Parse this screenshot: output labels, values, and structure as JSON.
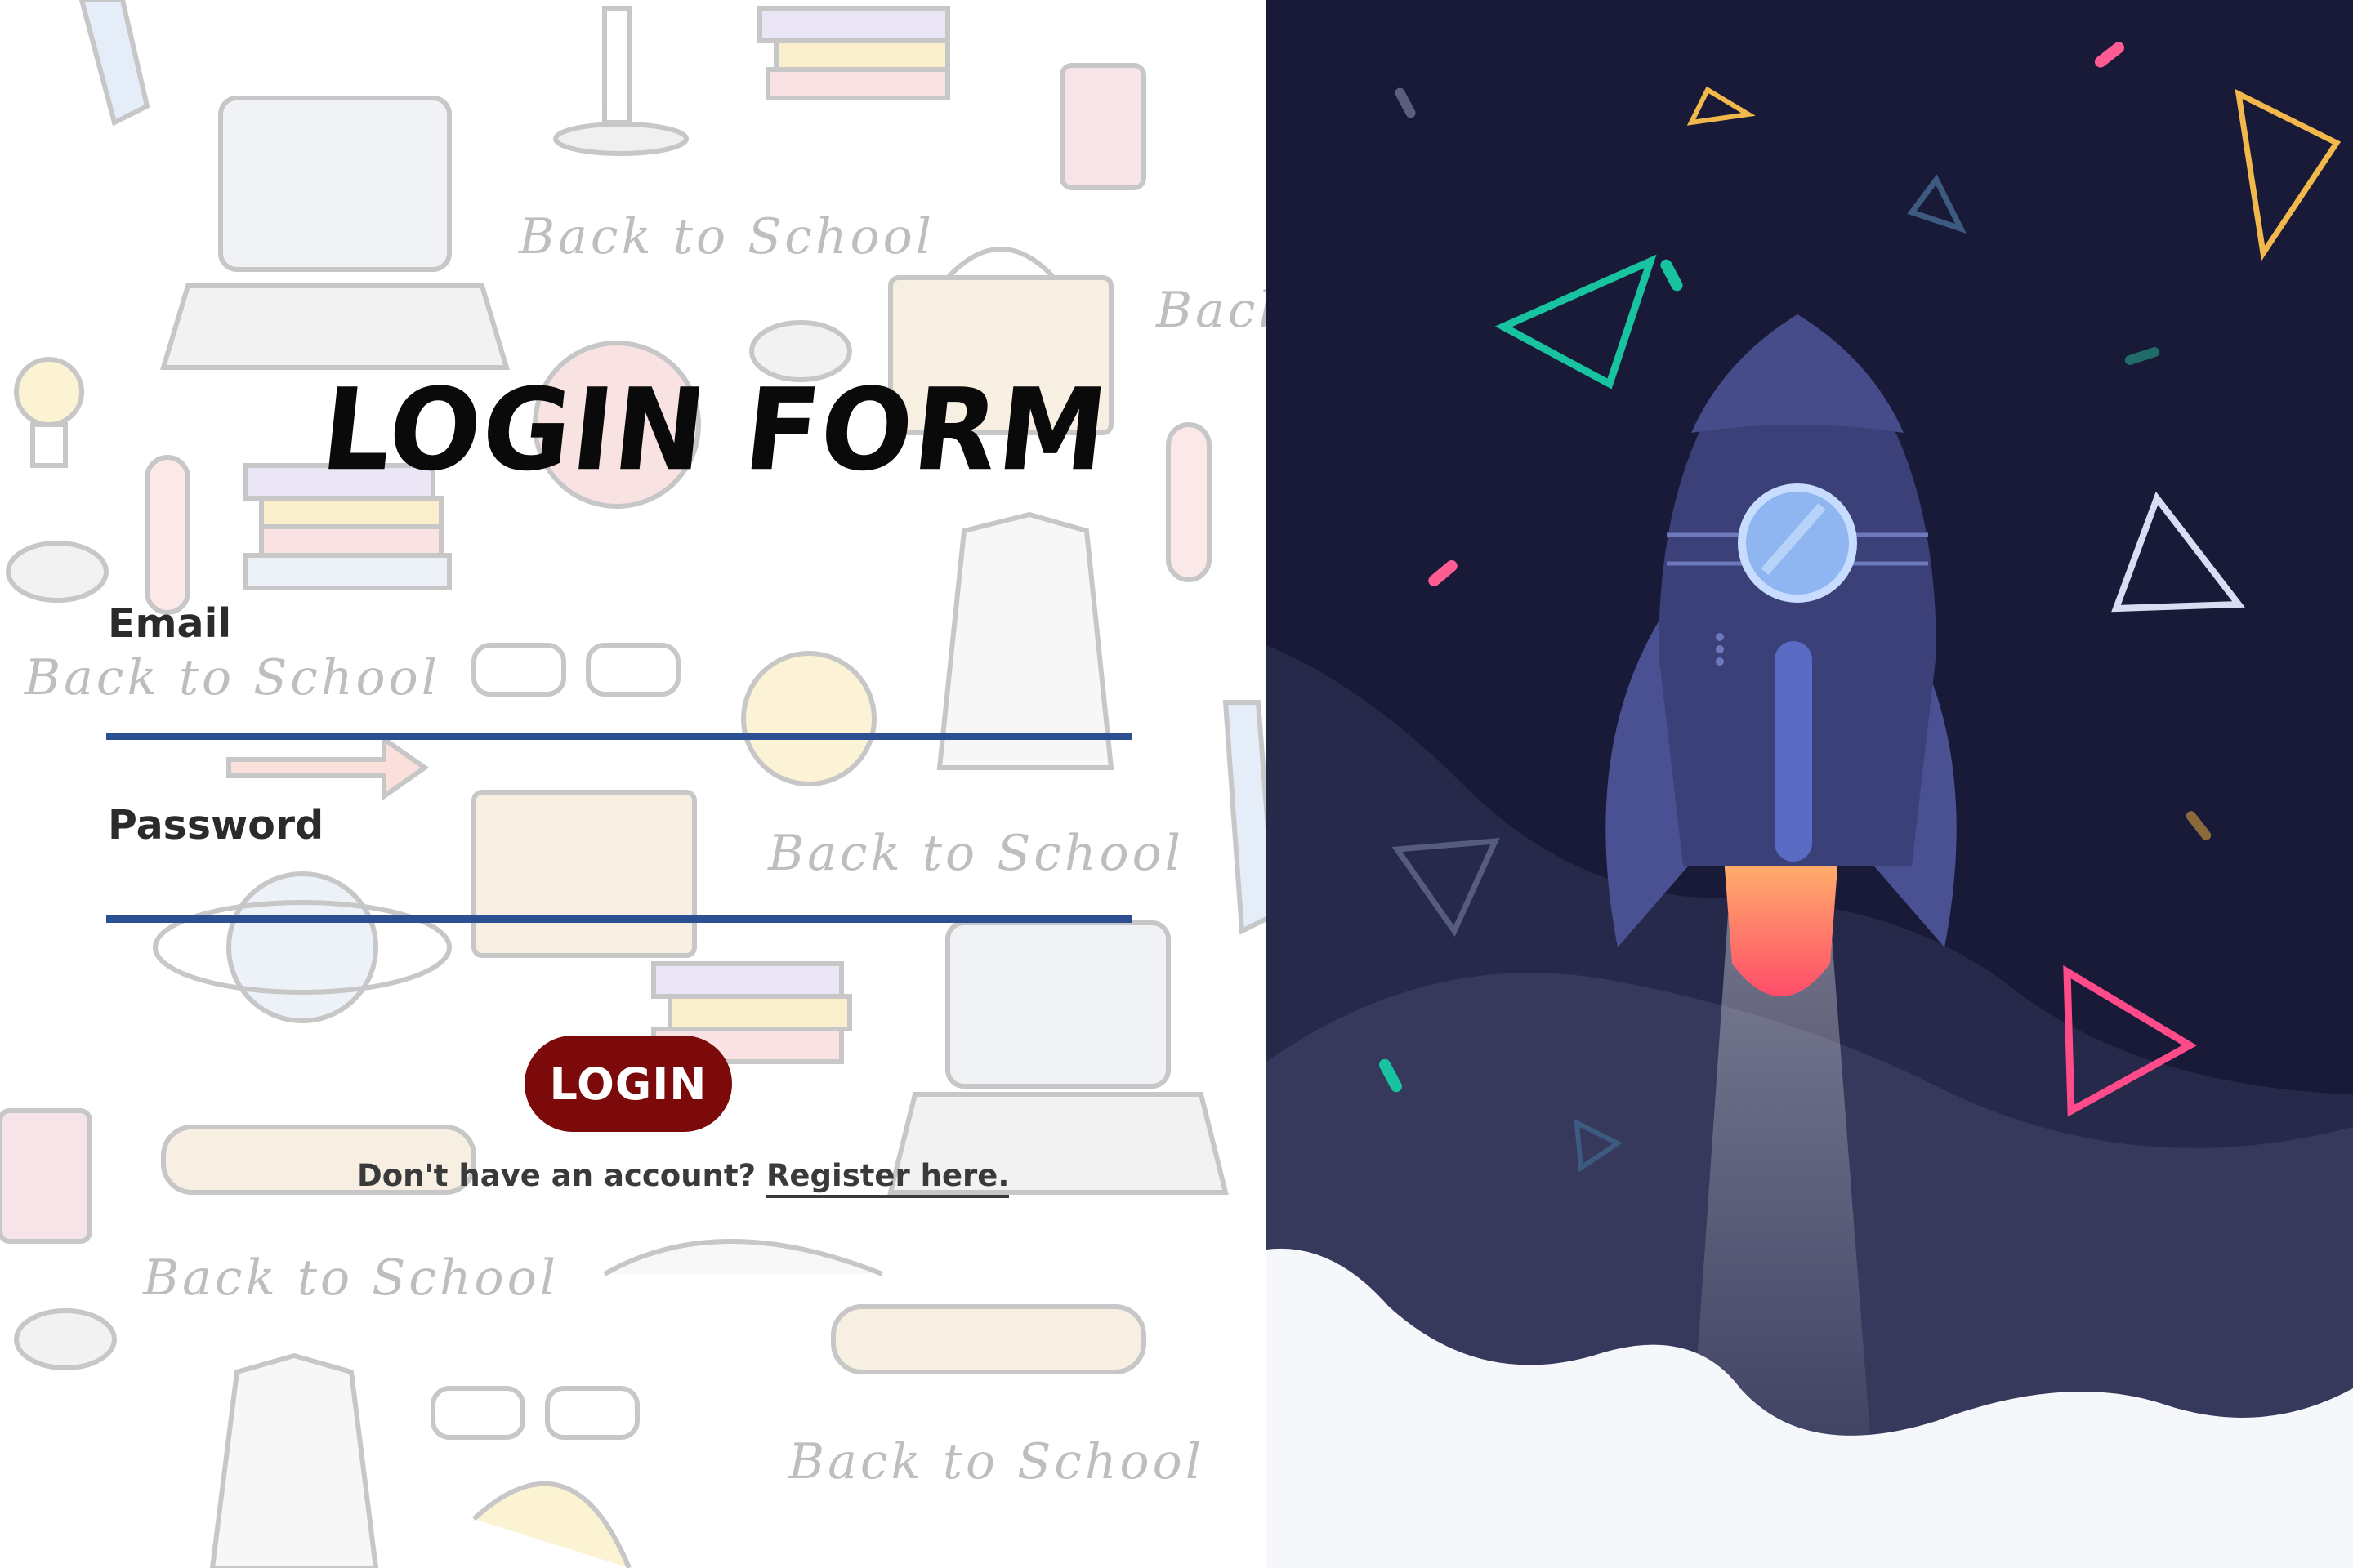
{
  "background": {
    "pattern_texts": [
      "Back to School",
      "Back to School",
      "Back to School",
      "Back to School",
      "Back to School",
      "Back to School"
    ]
  },
  "form": {
    "title": "LOGIN FORM",
    "email_label": "Email",
    "email_value": "",
    "password_label": "Password",
    "password_value": "",
    "login_label": "LOGIN",
    "register_prompt": "Don't have an account?",
    "register_link": "Register here."
  },
  "colors": {
    "input_underline": "#2c4f91",
    "login_button": "#7c0a0a",
    "right_background": "#181a38",
    "rocket_body": "#3b4178",
    "rocket_window": "#8fb6f0",
    "flame": "#ff5a5a"
  },
  "illustration": {
    "icons": [
      "rocket-icon",
      "triangle-icon",
      "confetti-icon",
      "cloud-icon"
    ]
  }
}
